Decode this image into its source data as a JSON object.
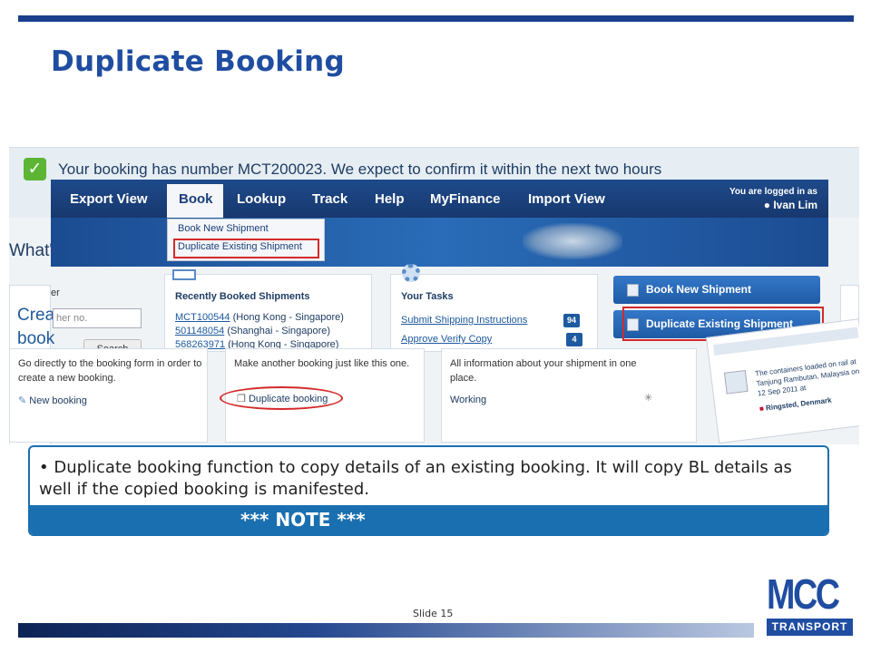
{
  "slide": {
    "title": "Duplicate Booking",
    "slide_number": "Slide 15"
  },
  "screenshot": {
    "confirmation": "Your booking has number MCT200023. We expect to confirm it within the next two hours",
    "whats_heading": "What'",
    "nav": {
      "items": [
        "Export View",
        "Book",
        "Lookup",
        "Track",
        "Help",
        "MyFinance",
        "Import View"
      ],
      "active": "Book",
      "login_label": "You are logged in as",
      "user": "Ivan Lim"
    },
    "book_menu": {
      "items": [
        "Book New Shipment",
        "Duplicate Existing Shipment"
      ],
      "highlighted": "Duplicate Existing Shipment"
    },
    "left_card": {
      "title_line1": "Crea",
      "title_line2": "book",
      "er_label": "er",
      "input_placeholder": "her no.",
      "search_label": "Search"
    },
    "recently_booked": {
      "title": "Recently Booked Shipments",
      "rows": [
        {
          "number": "MCT100544",
          "route": "(Hong Kong - Singapore)"
        },
        {
          "number": "501148054",
          "route": "(Shanghai - Singapore)"
        },
        {
          "number": "568263971",
          "route": "(Hong Kong - Singapore)"
        }
      ]
    },
    "your_tasks": {
      "title": "Your Tasks",
      "tasks": [
        {
          "label": "Submit Shipping Instructions",
          "count": "94"
        },
        {
          "label": "Approve Verify Copy",
          "count": "4"
        }
      ]
    },
    "buttons": {
      "book_new": "Book New Shipment",
      "duplicate_existing": "Duplicate Existing Shipment"
    },
    "lower_cards": {
      "card1_text": "Go directly to the booking form in order to create a new booking.",
      "card1_link": "New booking",
      "card2_text": "Make another booking just like this one.",
      "card2_link": "Duplicate booking",
      "card3_text": "All information about your shipment in one place.",
      "card3_status": "Working"
    },
    "side_panel": {
      "text": "The containers loaded on rail at Tanjung Rambutan, Malaysia on 12 Sep 2011 at",
      "flag_text": "Ringsted, Denmark"
    }
  },
  "note": {
    "bullet": "Duplicate booking function to copy details of an existing booking. It will copy BL details as well if the copied booking is manifested.",
    "title": "*** NOTE ***"
  },
  "logo": {
    "brand": "MCC",
    "subtitle": "TRANSPORT"
  },
  "colors": {
    "accent": "#1f4da1",
    "nav": "#17386e",
    "highlight": "#d42a2a",
    "note": "#1a6fb0"
  }
}
